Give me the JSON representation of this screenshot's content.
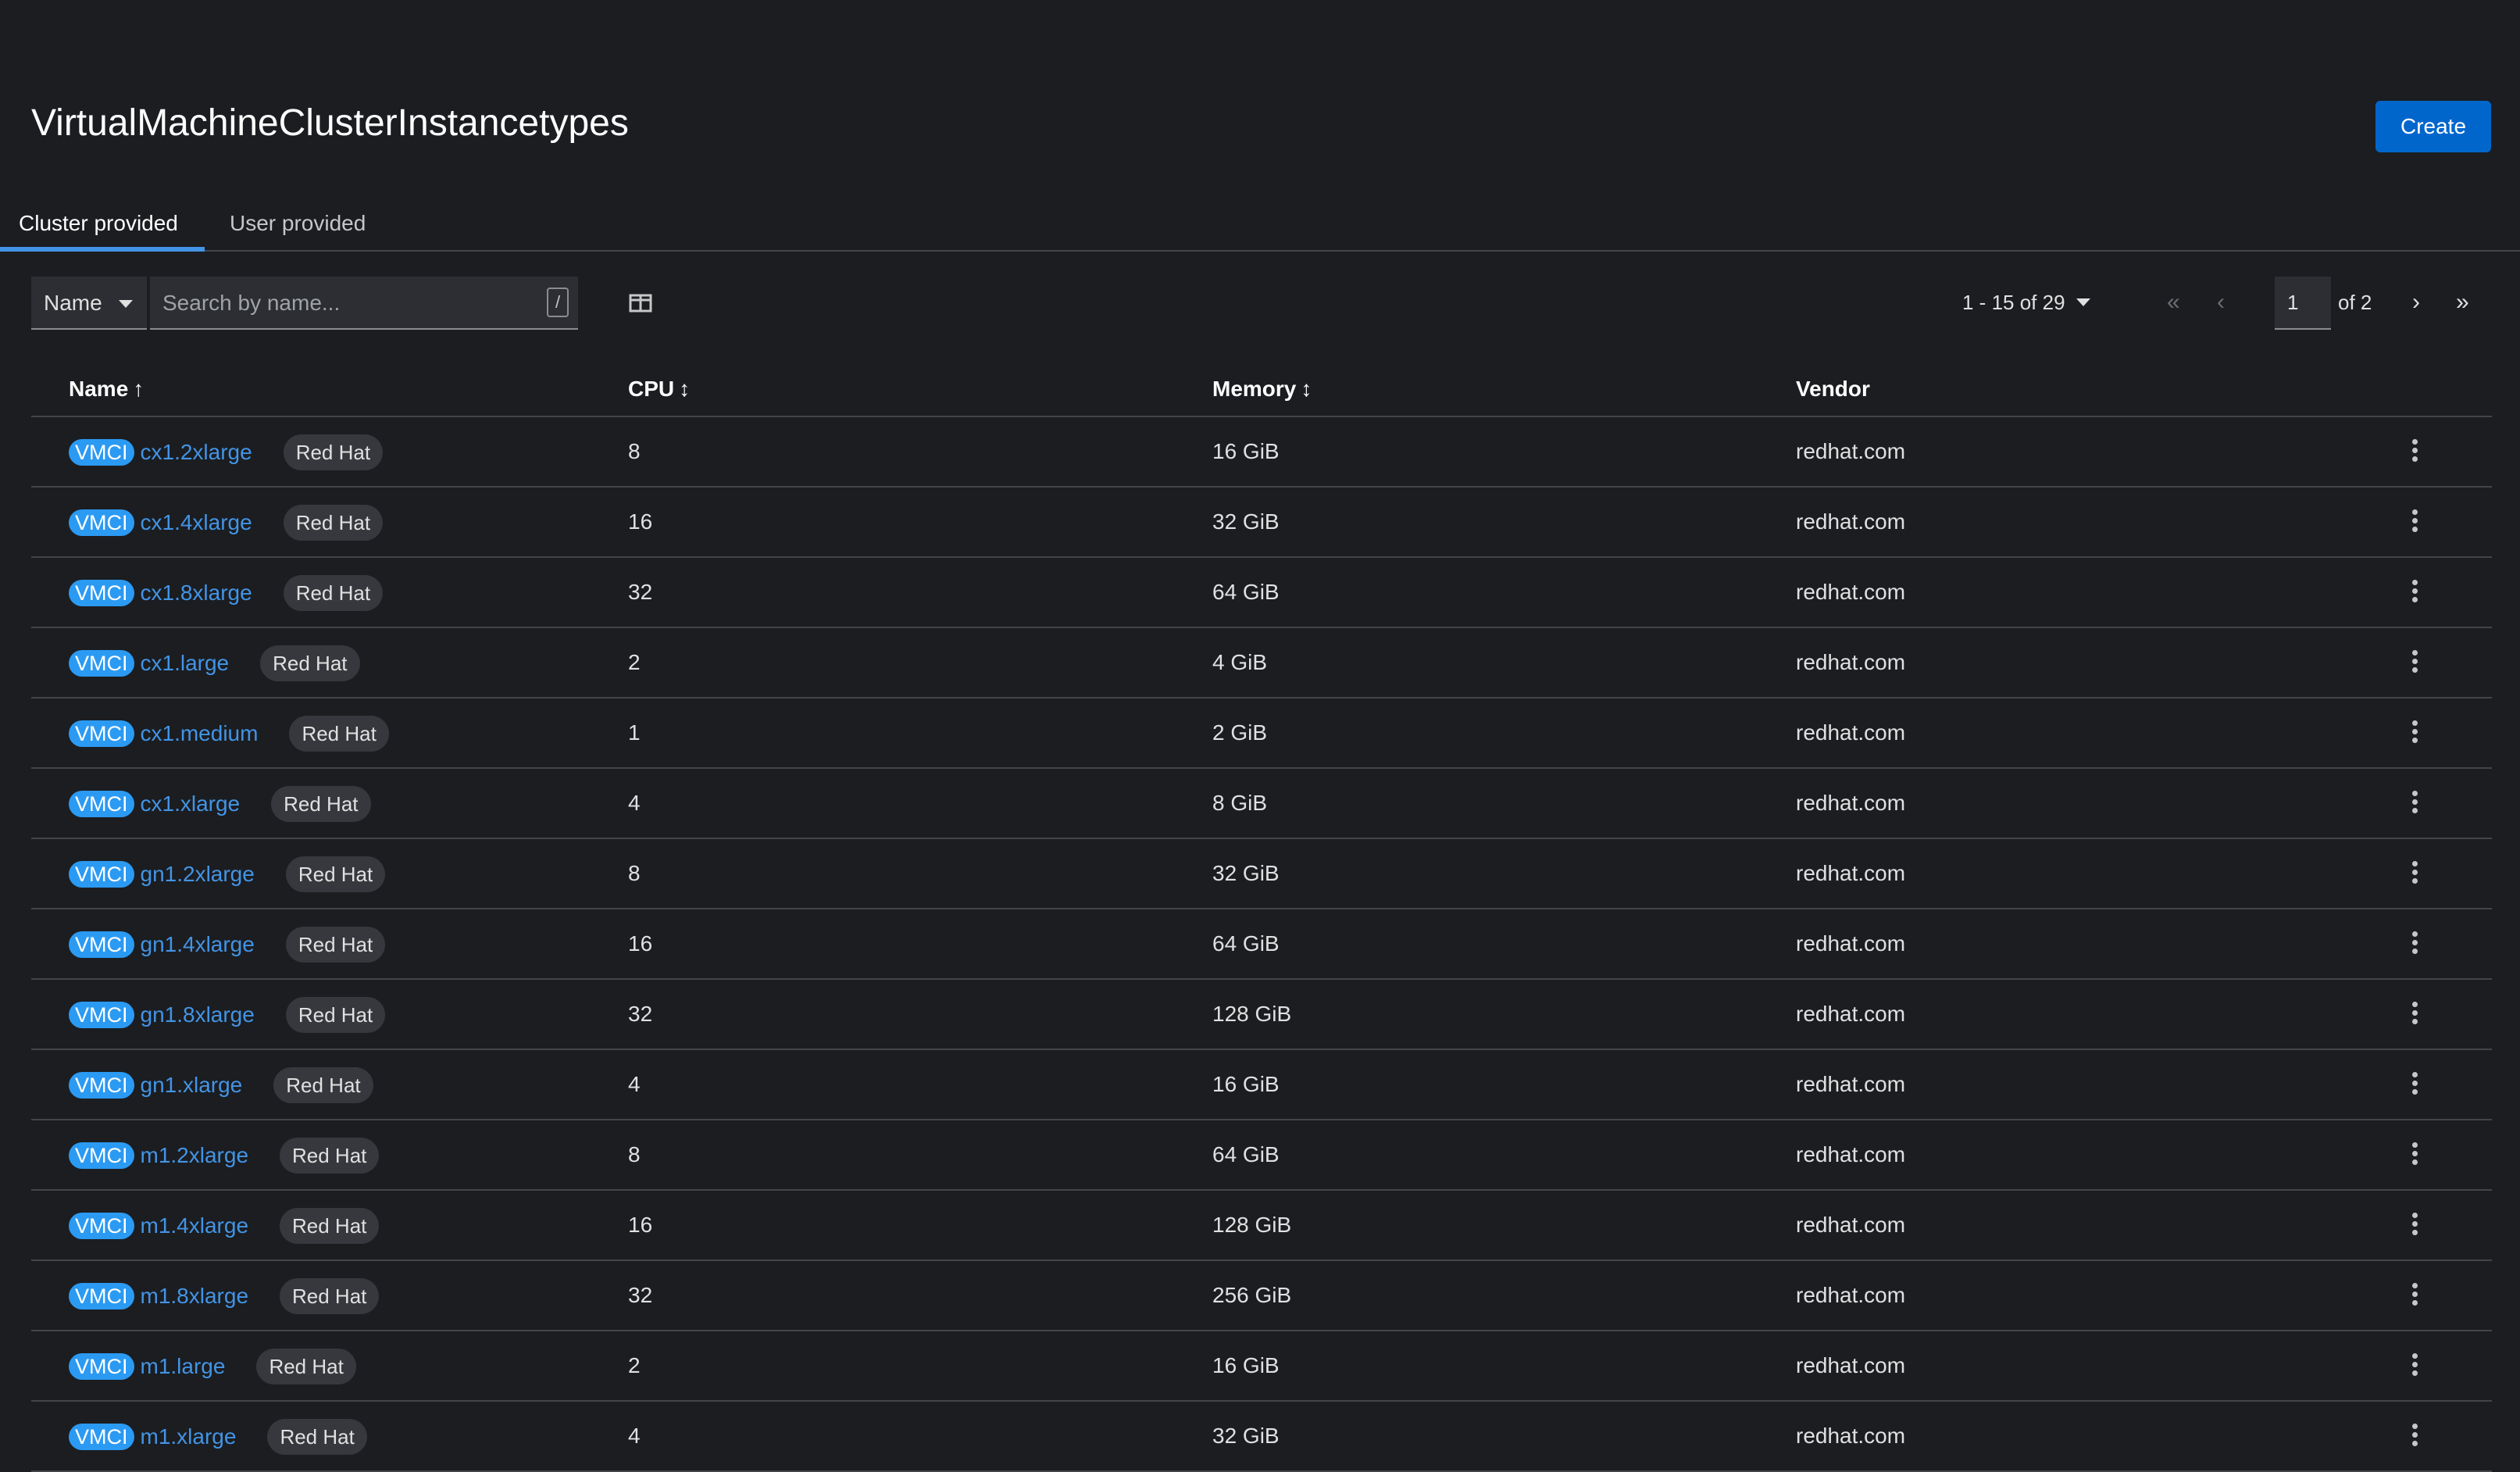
{
  "page": {
    "title": "VirtualMachineClusterInstancetypes",
    "create_label": "Create"
  },
  "tabs": [
    {
      "label": "Cluster provided",
      "active": true
    },
    {
      "label": "User provided",
      "active": false
    }
  ],
  "toolbar": {
    "filter_label": "Name",
    "search_placeholder": "Search by name...",
    "search_value": "",
    "shortcut_hint": "/",
    "columns_icon": "columns-icon"
  },
  "pagination": {
    "summary": "1 - 15 of 29",
    "page": "1",
    "of_label": "of 2"
  },
  "table": {
    "headers": {
      "name": "Name",
      "cpu": "CPU",
      "memory": "Memory",
      "vendor": "Vendor"
    },
    "sort": {
      "name": "ascending",
      "cpu": "unsorted",
      "memory": "unsorted"
    },
    "rows": [
      {
        "kind": "VMCI",
        "name": "cx1.2xlarge",
        "label": "Red Hat",
        "cpu": "8",
        "memory": "16 GiB",
        "vendor": "redhat.com"
      },
      {
        "kind": "VMCI",
        "name": "cx1.4xlarge",
        "label": "Red Hat",
        "cpu": "16",
        "memory": "32 GiB",
        "vendor": "redhat.com"
      },
      {
        "kind": "VMCI",
        "name": "cx1.8xlarge",
        "label": "Red Hat",
        "cpu": "32",
        "memory": "64 GiB",
        "vendor": "redhat.com"
      },
      {
        "kind": "VMCI",
        "name": "cx1.large",
        "label": "Red Hat",
        "cpu": "2",
        "memory": "4 GiB",
        "vendor": "redhat.com"
      },
      {
        "kind": "VMCI",
        "name": "cx1.medium",
        "label": "Red Hat",
        "cpu": "1",
        "memory": "2 GiB",
        "vendor": "redhat.com"
      },
      {
        "kind": "VMCI",
        "name": "cx1.xlarge",
        "label": "Red Hat",
        "cpu": "4",
        "memory": "8 GiB",
        "vendor": "redhat.com"
      },
      {
        "kind": "VMCI",
        "name": "gn1.2xlarge",
        "label": "Red Hat",
        "cpu": "8",
        "memory": "32 GiB",
        "vendor": "redhat.com"
      },
      {
        "kind": "VMCI",
        "name": "gn1.4xlarge",
        "label": "Red Hat",
        "cpu": "16",
        "memory": "64 GiB",
        "vendor": "redhat.com"
      },
      {
        "kind": "VMCI",
        "name": "gn1.8xlarge",
        "label": "Red Hat",
        "cpu": "32",
        "memory": "128 GiB",
        "vendor": "redhat.com"
      },
      {
        "kind": "VMCI",
        "name": "gn1.xlarge",
        "label": "Red Hat",
        "cpu": "4",
        "memory": "16 GiB",
        "vendor": "redhat.com"
      },
      {
        "kind": "VMCI",
        "name": "m1.2xlarge",
        "label": "Red Hat",
        "cpu": "8",
        "memory": "64 GiB",
        "vendor": "redhat.com"
      },
      {
        "kind": "VMCI",
        "name": "m1.4xlarge",
        "label": "Red Hat",
        "cpu": "16",
        "memory": "128 GiB",
        "vendor": "redhat.com"
      },
      {
        "kind": "VMCI",
        "name": "m1.8xlarge",
        "label": "Red Hat",
        "cpu": "32",
        "memory": "256 GiB",
        "vendor": "redhat.com"
      },
      {
        "kind": "VMCI",
        "name": "m1.large",
        "label": "Red Hat",
        "cpu": "2",
        "memory": "16 GiB",
        "vendor": "redhat.com"
      },
      {
        "kind": "VMCI",
        "name": "m1.xlarge",
        "label": "Red Hat",
        "cpu": "4",
        "memory": "32 GiB",
        "vendor": "redhat.com"
      }
    ]
  },
  "colors": {
    "background": "#1b1d21",
    "primary": "#0066cc",
    "link": "#4394e5",
    "badge": "#2b9af3",
    "label_bg": "#36383d",
    "divider": "#444548"
  }
}
